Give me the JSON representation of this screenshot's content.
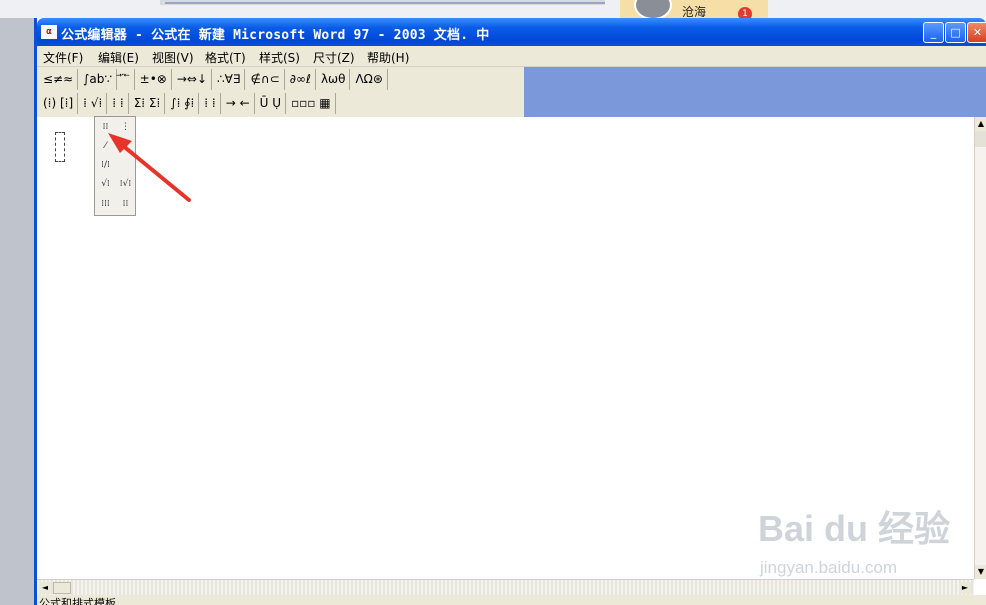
{
  "desktop": {
    "contact_name": "沧海",
    "badge_count": "1"
  },
  "window": {
    "title": "公式编辑器 - 公式在 新建 Microsoft Word 97 - 2003 文档. 中",
    "minimize_label": "_",
    "maximize_label": "□",
    "close_label": "✕",
    "icon_label": "α"
  },
  "menubar": {
    "items": [
      "文件(F)",
      "编辑(E)",
      "视图(V)",
      "格式(T)",
      "样式(S)",
      "尺寸(Z)",
      "帮助(H)"
    ]
  },
  "palette": {
    "row1": [
      "≤≠≈",
      "∫ab∵",
      "⃗ ⃛ ⃖",
      "±•⊗",
      "→⇔↓",
      "∴∀∃",
      "∉∩⊂",
      "∂∞ℓ",
      "λωθ",
      "ΛΩ⊛"
    ],
    "row2": [
      "(⁞) [⁞]",
      "⁞ √⁞",
      "⁞ ⁞",
      "Σ⁞ Σ⁞",
      "∫⁞ ∮⁞",
      "⁞ ⁞",
      "→ ←",
      "Ū Ụ",
      "▫▫▫ ▦"
    ]
  },
  "dropdown": {
    "cells": [
      "⁞⁞",
      "⋮",
      "⁄",
      "√",
      "⁞/⁞",
      "",
      "√⁞",
      "⁞√⁞",
      "⁞⁞⁞",
      "⁞⁞"
    ]
  },
  "scroll": {
    "up": "▲",
    "down": "▼",
    "left": "◄",
    "right": "►"
  },
  "status": {
    "text": "公式和排式模板"
  },
  "watermark": {
    "logo_text": "Bai du 经验",
    "url": "jingyan.baidu.com"
  },
  "colors": {
    "title_blue": "#0a5ce6",
    "toolbar_blue": "#7b98db",
    "arrow_red": "#e8332a"
  }
}
